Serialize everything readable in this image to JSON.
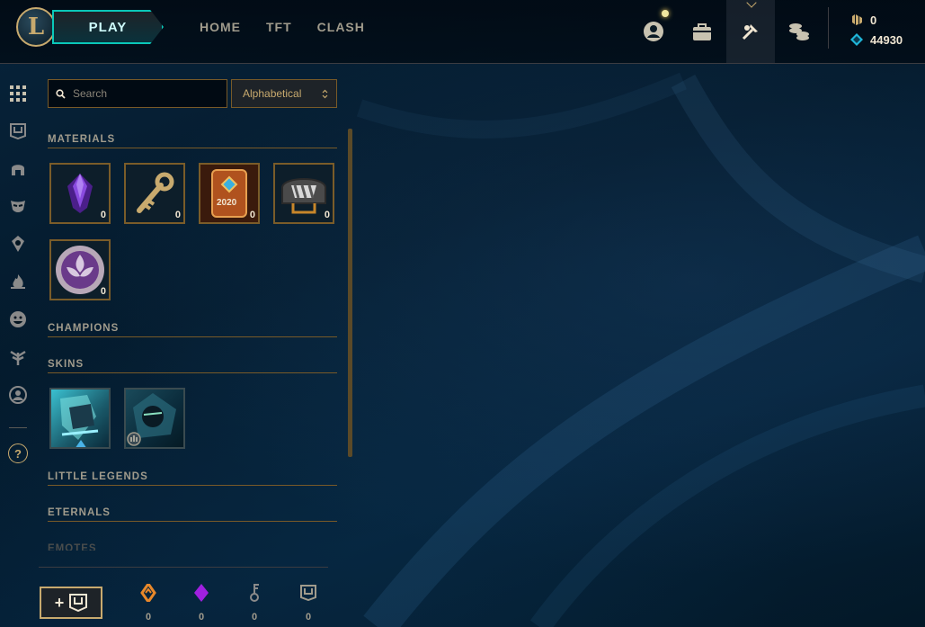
{
  "topbar": {
    "logo_letter": "L",
    "play_label": "PLAY",
    "nav": [
      {
        "label": "HOME"
      },
      {
        "label": "TFT"
      },
      {
        "label": "CLASH"
      }
    ],
    "icons": [
      "profile-icon",
      "store-bag-icon",
      "crafting-icon",
      "currency-stack-icon"
    ],
    "currency": {
      "rp_value": "0",
      "blue_essence_value": "44930"
    }
  },
  "rail": {
    "items": [
      "all-grid-icon",
      "chest-icon",
      "helmet-icon",
      "mask-icon",
      "ward-icon",
      "flame-icon",
      "emote-icon",
      "tree-icon",
      "icon-frame-icon"
    ],
    "help_label": "?"
  },
  "panel": {
    "search": {
      "placeholder": "Search",
      "value": ""
    },
    "sort": {
      "selected": "Alphabetical"
    },
    "sections": {
      "materials": "MATERIALS",
      "champions": "CHAMPIONS",
      "skins": "SKINS",
      "little_legends": "LITTLE LEGENDS",
      "eternals": "ETERNALS",
      "emotes": "EMOTES"
    },
    "materials": [
      {
        "name": "gemstone",
        "count": "0"
      },
      {
        "name": "hextech-key",
        "count": "0"
      },
      {
        "name": "event-pass-token",
        "count": "0",
        "year_text": "2020"
      },
      {
        "name": "masterwork-chest",
        "count": "0"
      },
      {
        "name": "orb",
        "count": "0"
      }
    ]
  },
  "footer": {
    "stats": [
      {
        "name": "orange-essence",
        "value": "0"
      },
      {
        "name": "mythic-essence",
        "value": "0"
      },
      {
        "name": "key-fragment",
        "value": "0"
      },
      {
        "name": "chest",
        "value": "0"
      }
    ]
  },
  "colors": {
    "gold": "#c8aa6e",
    "teal": "#0ac8b9",
    "background": "#031420"
  }
}
